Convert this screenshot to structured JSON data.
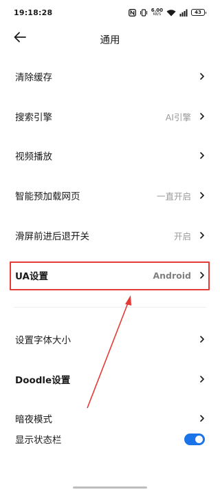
{
  "status_bar": {
    "time": "19:18:28",
    "net_speed_value": "6.00",
    "net_speed_unit": "KB/S",
    "battery_level": "43",
    "icons": [
      "nfc-icon",
      "vibrate-icon",
      "wifi-icon",
      "cellular-signal-icon",
      "battery-icon"
    ]
  },
  "header": {
    "title": "通用",
    "back_icon": "arrow-left-icon"
  },
  "settings": {
    "items": [
      {
        "label": "清除缓存",
        "value": ""
      },
      {
        "label": "搜索引擎",
        "value": "AI引擎"
      },
      {
        "label": "视频播放",
        "value": ""
      },
      {
        "label": "智能预加载网页",
        "value": "一直开启"
      },
      {
        "label": "滑屏前进后退开关",
        "value": "开启"
      },
      {
        "label": "UA设置",
        "value": "Android",
        "highlighted": true
      },
      {
        "label": "设置字体大小",
        "value": ""
      },
      {
        "label": "Doodle设置",
        "value": ""
      },
      {
        "label": "暗夜模式",
        "value": ""
      },
      {
        "label": "显示状态栏",
        "toggle_on": true
      }
    ]
  },
  "colors": {
    "accent": "#1a73e8",
    "annotation": "#e53935",
    "secondary_text": "#9a9a9a"
  }
}
